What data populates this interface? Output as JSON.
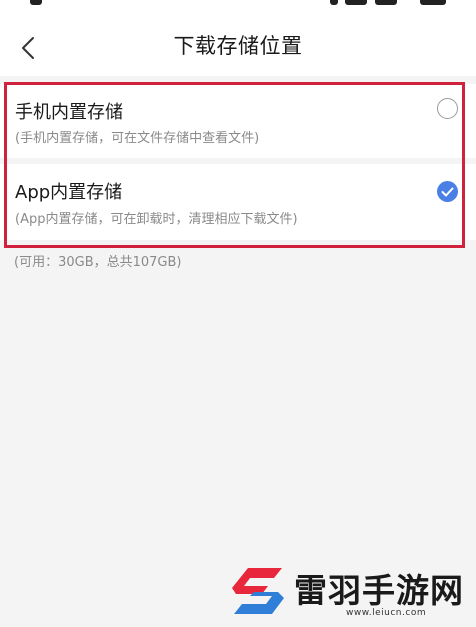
{
  "header": {
    "title": "下载存储位置",
    "back_icon": "chevron-left-icon"
  },
  "options": [
    {
      "title": "手机内置存储",
      "description": "(手机内置存储，可在文件存储中查看文件)",
      "selected": false
    },
    {
      "title": "App内置存储",
      "description": "(App内置存储，可在卸载时，清理相应下载文件)",
      "selected": true
    }
  ],
  "storage_info": "(可用：30GB，总共107GB)",
  "watermark": {
    "name": "雷羽手游网",
    "url": "www.leiucn.com"
  },
  "colors": {
    "accent": "#4a80e6",
    "highlight_frame": "#d0213d",
    "logo_red": "#e8263c",
    "logo_blue": "#2f7fd9"
  }
}
